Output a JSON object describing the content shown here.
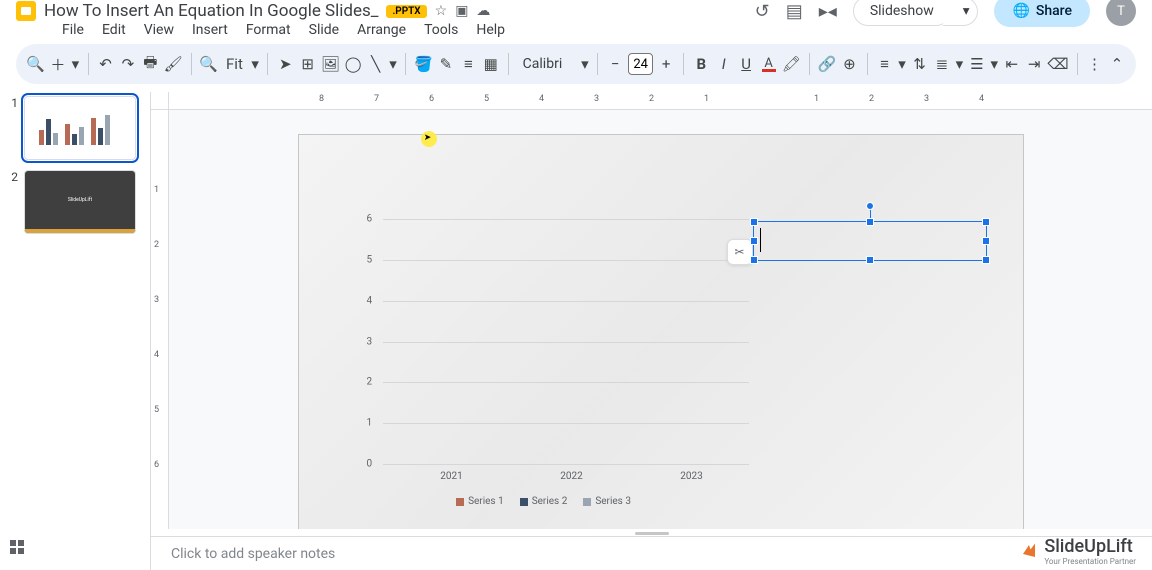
{
  "header": {
    "doc_title": "How To Insert An Equation In Google Slides_",
    "badge": ".PPTX",
    "slideshow_label": "Slideshow",
    "share_label": "Share",
    "avatar_initial": "T"
  },
  "menu": {
    "items": [
      "File",
      "Edit",
      "View",
      "Insert",
      "Format",
      "Slide",
      "Arrange",
      "Tools",
      "Help"
    ]
  },
  "toolbar": {
    "zoom_label": "Fit",
    "font_name": "Calibri",
    "font_size": "24"
  },
  "sidebar": {
    "slides": [
      {
        "num": "1",
        "selected": true
      },
      {
        "num": "2",
        "selected": false,
        "label": "SlideUpLift"
      }
    ]
  },
  "ruler_h_labels": [
    "8",
    "7",
    "6",
    "5",
    "4",
    "3",
    "2",
    "1",
    "",
    "1",
    "2",
    "3",
    "4"
  ],
  "ruler_v_labels": [
    "",
    "1",
    "2",
    "3",
    "4",
    "5",
    "6"
  ],
  "chart_data": {
    "type": "bar",
    "categories": [
      "2021",
      "2022",
      "2023"
    ],
    "series": [
      {
        "name": "Series 1",
        "color": "#b76a54",
        "values": [
          2.5,
          3.5,
          4.5
        ]
      },
      {
        "name": "Series 2",
        "color": "#3b5066",
        "values": [
          4.4,
          1.8,
          2.8
        ]
      },
      {
        "name": "Series 3",
        "color": "#99a5b0",
        "values": [
          2.0,
          3.0,
          5.0
        ]
      }
    ],
    "ylim": [
      0,
      6
    ],
    "yticks": [
      0,
      1,
      2,
      3,
      4,
      5,
      6
    ],
    "xlabel": "",
    "ylabel": "",
    "title": ""
  },
  "notes": {
    "placeholder": "Click to add speaker notes"
  },
  "watermark": {
    "brand": "SlideUpLift",
    "tagline": "Your Presentation Partner"
  }
}
